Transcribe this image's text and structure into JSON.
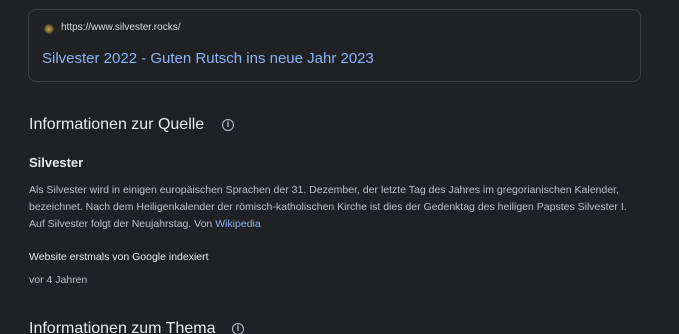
{
  "result": {
    "url": "https://www.silvester.rocks/",
    "title": "Silvester 2022 - Guten Rutsch ins neue Jahr 2023"
  },
  "source_section": {
    "heading": "Informationen zur Quelle",
    "subject": "Silvester",
    "description_text": "Als Silvester wird in einigen europäischen Sprachen der 31. Dezember, der letzte Tag des Jahres im gregorianischen Kalender, bezeichnet. Nach dem Heiligenkalender der römisch-katholischen Kirche ist dies der Gedenktag des heiligen Papstes Silvester I. Auf Silvester folgt der Neujahrstag. Von ",
    "description_link": "Wikipedia",
    "indexed_label": "Website erstmals von Google indexiert",
    "indexed_value": "vor 4 Jahren"
  },
  "topic_section": {
    "heading": "Informationen zum Thema"
  },
  "icons": {
    "favicon": "site-favicon-icon",
    "info": "info-icon"
  },
  "colors": {
    "background": "#202124",
    "link": "#8ab4f8",
    "text_primary": "#e8eaed",
    "text_secondary": "#bdc1c6",
    "border": "#3c4043"
  }
}
